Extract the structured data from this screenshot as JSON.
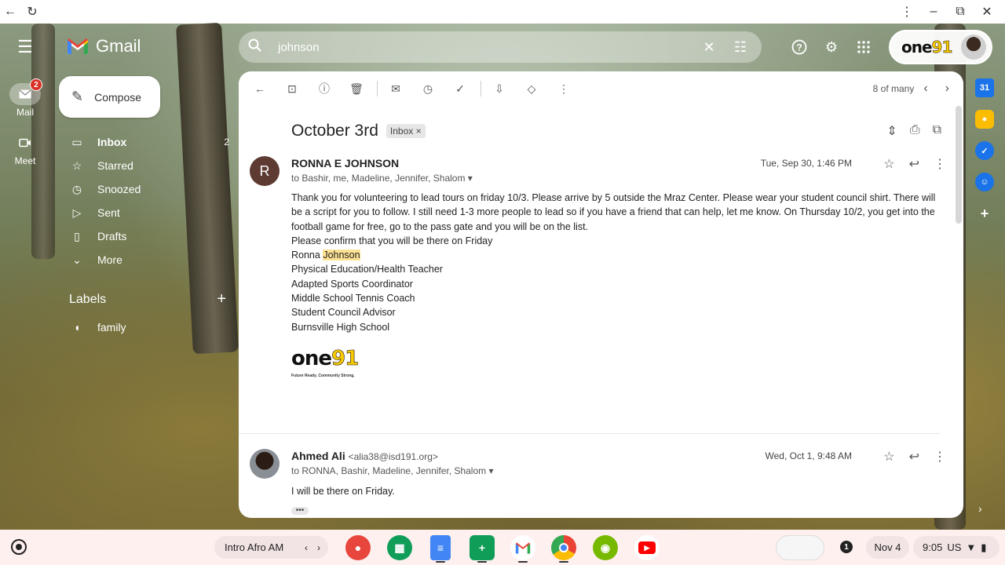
{
  "browser": {
    "back": "←",
    "reload": "↻",
    "menu": "⋮",
    "minimize": "–",
    "restore": "⧉",
    "close": "✕"
  },
  "rail": {
    "mail": {
      "label": "Mail",
      "badge": "2",
      "icon": "mail-icon"
    },
    "meet": {
      "label": "Meet",
      "icon": "video-icon"
    }
  },
  "header": {
    "app_name": "Gmail",
    "search_query": "johnson",
    "account_logo": {
      "one": "one",
      "n91": "91"
    }
  },
  "compose_label": "Compose",
  "nav": [
    {
      "label": "Inbox",
      "count": "2",
      "icon": "inbox-icon"
    },
    {
      "label": "Starred",
      "count": "",
      "icon": "star-icon"
    },
    {
      "label": "Snoozed",
      "count": "",
      "icon": "clock-icon"
    },
    {
      "label": "Sent",
      "count": "",
      "icon": "send-icon"
    },
    {
      "label": "Drafts",
      "count": "",
      "icon": "draft-icon"
    },
    {
      "label": "More",
      "count": "",
      "icon": "chevron-down-icon"
    }
  ],
  "labels": {
    "title": "Labels",
    "items": [
      {
        "label": "family"
      }
    ]
  },
  "toolbar": {
    "position": "8 of many"
  },
  "thread": {
    "subject": "October 3rd",
    "chip": "Inbox",
    "messages": [
      {
        "avatar_letter": "R",
        "sender": "RONNA E JOHNSON",
        "email": "",
        "to": "to Bashir, me, Madeline, Jennifer, Shalom",
        "date": "Tue, Sep 30, 1:46 PM",
        "body": "Thank you for volunteering to lead tours on friday 10/3. Please arrive by 5 outside the Mraz Center. Please wear your student council shirt. There will be a script for you to follow. I still need 1-3 more people to lead so if you have a friend that can help, let me know. On Thursday 10/2, you get into the football game for free, go to the pass gate and you will be on the list.",
        "confirm": "Please confirm that you will be there on Friday",
        "sig_first": "Ronna",
        "sig_last": "Johnson",
        "sig_lines": [
          "Physical Education/Health Teacher",
          "Adapted Sports Coordinator",
          "Middle School Tennis Coach",
          "Student Council Advisor",
          "Burnsville High School"
        ],
        "logo": {
          "one": "one",
          "n91": "91",
          "tagline": "Future Ready. Community Strong."
        }
      },
      {
        "sender": "Ahmed Ali",
        "email": "<alia38@isd191.org>",
        "to": "to RONNA, Bashir, Madeline, Jennifer, Shalom",
        "date": "Wed, Oct 1, 9:48 AM",
        "body": "I will be there on Friday.",
        "ellipsis": "•••"
      }
    ]
  },
  "shelf": {
    "desk": "Intro Afro AM",
    "notif_count": "1",
    "date": "Nov 4",
    "time": "9:05",
    "region": "US"
  },
  "colors": {
    "accent_red": "#d93025",
    "highlight": "#fde293",
    "avatar_brown": "#5d3a32"
  }
}
